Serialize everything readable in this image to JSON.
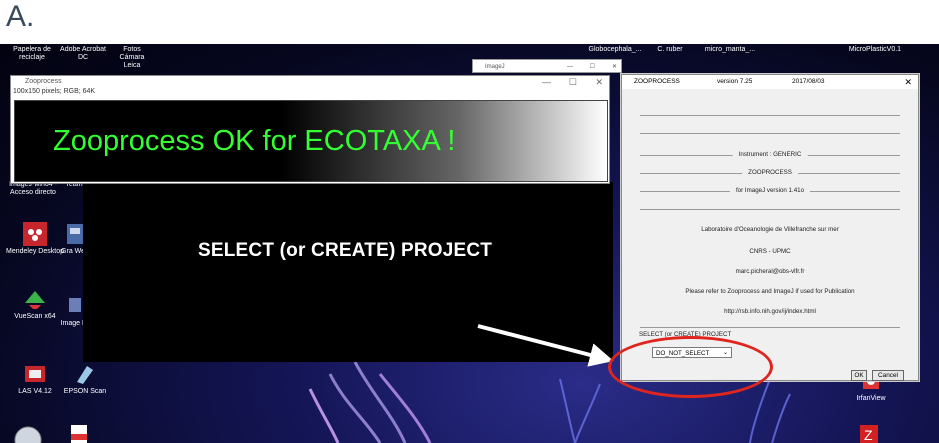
{
  "panel_label": "A.",
  "desktop": {
    "top_icons": [
      {
        "name": "papelera-icon",
        "label": "Papelera de reciclaje"
      },
      {
        "name": "adobe-acrobat-icon",
        "label": "Adobe Acrobat DC"
      },
      {
        "name": "fotos-camara-icon",
        "label": "Fotos Cámara Leica"
      }
    ],
    "top_right_labels": [
      {
        "name": "globocephala-folder-label",
        "label": "Globocephala_..."
      },
      {
        "name": "c-ruber-folder-label",
        "label": "C. ruber"
      },
      {
        "name": "micro-manta-folder-label",
        "label": "micro_manta_..."
      },
      {
        "name": "microplastics-folder-label",
        "label": "MicroPlasticV0.1"
      }
    ],
    "left_icons": [
      {
        "name": "imagej-shortcut-icon",
        "label": "ImageJ-win64 - Acceso directo"
      },
      {
        "name": "mendeley-icon",
        "label": "Mendeley Desktop"
      },
      {
        "name": "vuescan-icon",
        "label": "VueScan x64"
      },
      {
        "name": "las-icon",
        "label": "LAS V4.12"
      },
      {
        "name": "epson-scan-icon",
        "label": "EPSON Scan"
      },
      {
        "name": "irfanview-icon",
        "label": "IrfanView"
      }
    ],
    "partial_labels": {
      "team": "Team",
      "gra": "Gra Web",
      "image": "Image Dr"
    }
  },
  "zooprocess_window": {
    "title": "Zooprocess",
    "subtitle": "100x150 pixels; RGB; 64K",
    "banner_text": "Zooprocess OK for ECOTAXA !",
    "banner_color": "#33ff33"
  },
  "imagej_window": {
    "title": "ImageJ"
  },
  "annotation": {
    "text": "SELECT (or CREATE) PROJECT",
    "circle_color": "#e0251e"
  },
  "dialog": {
    "title": "ZOOPROCESS",
    "version": "version 7.25",
    "date": "2017/08/03",
    "instrument": "Instrument : GENERIC",
    "zooprocess": "ZOOPROCESS",
    "imagej_version": "for ImageJ version 1.41o",
    "lab": "Laboratoire d'Oceanologie de Villefranche sur mer",
    "cnrs": "CNRS - UPMC",
    "email": "marc.picheral@obs-vlfr.fr",
    "refer": "Please refer to Zooprocess and ImageJ if used for Publication",
    "url": "http://rsb.info.nih.gov/ij/index.html",
    "select_label": "SELECT (or CREATE) PROJECT",
    "select_value": "DO_NOT_SELECT",
    "ok_label": "OK",
    "cancel_label": "Cancel"
  }
}
